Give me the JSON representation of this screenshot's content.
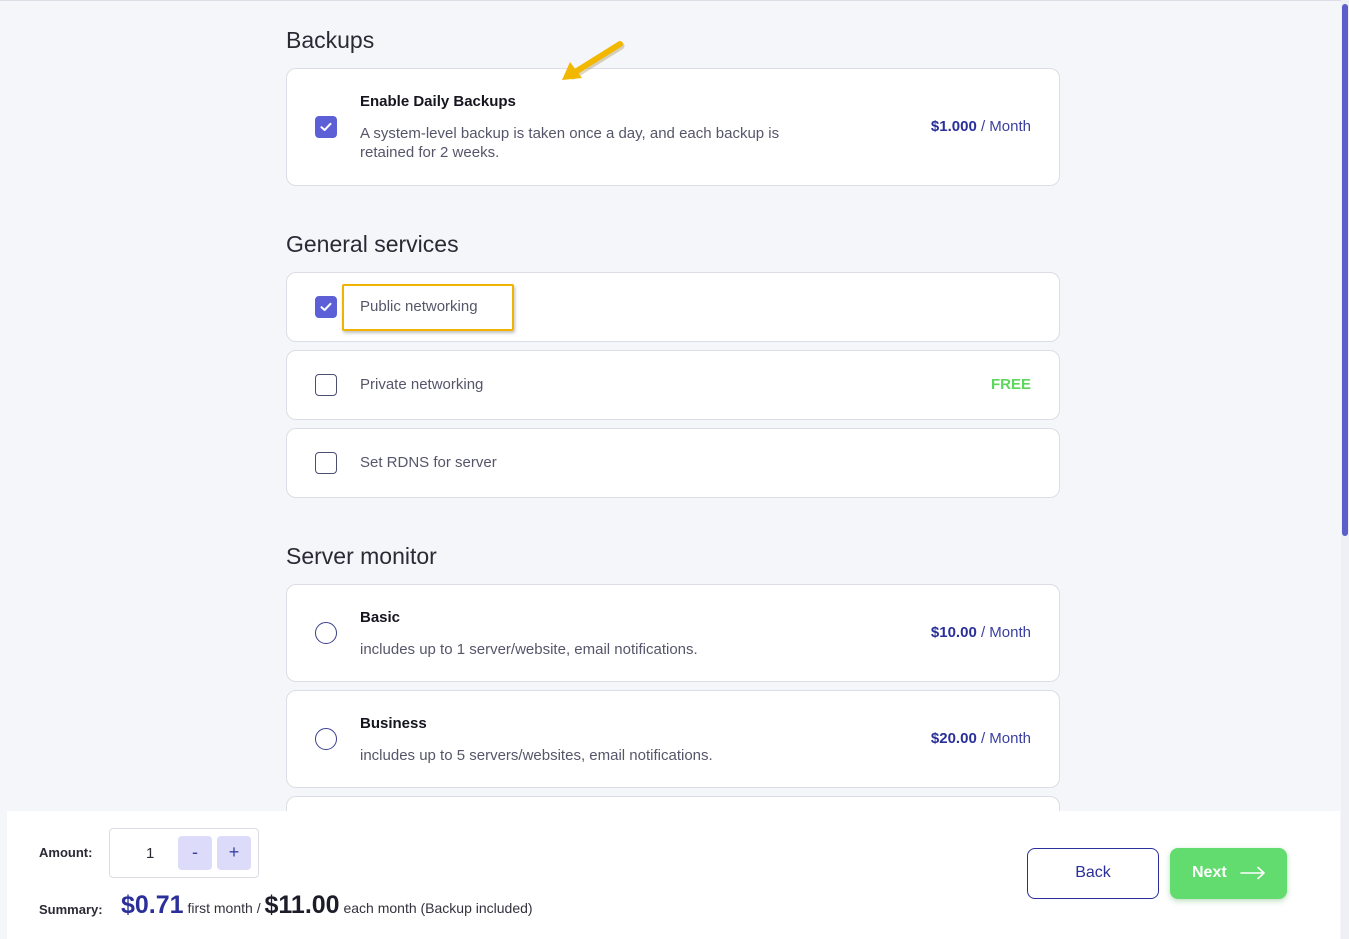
{
  "sections": {
    "backups": "Backups",
    "general": "General services",
    "monitor": "Server monitor"
  },
  "backup": {
    "title": "Enable Daily Backups",
    "description": "A system-level backup is taken once a day, and each backup is retained for 2 weeks.",
    "price": "$1.000",
    "period": "/ Month",
    "checked": true
  },
  "general_services": [
    {
      "label": "Public networking",
      "checked": true,
      "badge": ""
    },
    {
      "label": "Private networking",
      "checked": false,
      "badge": "FREE"
    },
    {
      "label": "Set RDNS for server",
      "checked": false,
      "badge": ""
    }
  ],
  "monitor_plans": [
    {
      "title": "Basic",
      "description": "includes up to 1 server/website, email notifications.",
      "price": "$10.00",
      "period": "/ Month"
    },
    {
      "title": "Business",
      "description": "includes up to 5 servers/websites, email notifications.",
      "price": "$20.00",
      "period": "/ Month"
    }
  ],
  "footer": {
    "amount_label": "Amount:",
    "amount_value": "1",
    "minus": "-",
    "plus": "+",
    "summary_label": "Summary:",
    "first_price": "$0.71",
    "first_text": "first month /",
    "monthly_price": "$11.00",
    "monthly_text": "each month (Backup included)",
    "back": "Back",
    "next": "Next"
  },
  "colors": {
    "accent": "#5c5fd6",
    "price": "#2a2f9a",
    "free": "#5cd65c",
    "next": "#62dc6e",
    "highlight": "#f0b400"
  },
  "icons": {
    "check": "check-icon",
    "arrow": "arrow-right-icon",
    "annotation": "annotation-arrow-icon"
  }
}
